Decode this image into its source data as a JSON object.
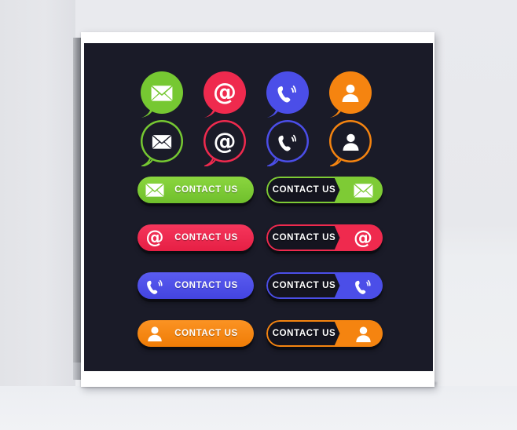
{
  "artboard": {
    "background_color": "#1a1b28",
    "frame_color": "#ffffff",
    "wall_color": "#e8e9ed"
  },
  "palette": {
    "green": "#76c832",
    "green_light": "#8bd63f",
    "red": "#ef2a4e",
    "red_light": "#f5365c",
    "blue": "#4b4ee8",
    "blue_light": "#5a5cf0",
    "orange": "#f58410",
    "orange_light": "#fb9323",
    "white": "#ffffff",
    "dark": "#14141f"
  },
  "bubbles_filled": [
    {
      "id": "bubble-filled-mail",
      "icon": "envelope-icon",
      "color": "#76c832",
      "style": "filled"
    },
    {
      "id": "bubble-filled-email",
      "icon": "at-sign-icon",
      "color": "#ef2a4e",
      "style": "filled"
    },
    {
      "id": "bubble-filled-phone",
      "icon": "phone-ringing-icon",
      "color": "#4b4ee8",
      "style": "filled"
    },
    {
      "id": "bubble-filled-user",
      "icon": "user-icon",
      "color": "#f58410",
      "style": "filled"
    }
  ],
  "bubbles_outline": [
    {
      "id": "bubble-outline-mail",
      "icon": "envelope-icon",
      "color": "#76c832",
      "style": "outline"
    },
    {
      "id": "bubble-outline-email",
      "icon": "at-sign-icon",
      "color": "#ef2a4e",
      "style": "outline"
    },
    {
      "id": "bubble-outline-phone",
      "icon": "phone-ringing-icon",
      "color": "#4b4ee8",
      "style": "outline"
    },
    {
      "id": "bubble-outline-user",
      "icon": "user-icon",
      "color": "#f58410",
      "style": "outline"
    }
  ],
  "buttons": {
    "label": "CONTACT US",
    "rows": [
      {
        "color": "#76c832",
        "icon": "envelope-icon",
        "solid": {
          "id": "contact-us-button-green-solid",
          "label": "CONTACT US",
          "icon_side": "left"
        },
        "split": {
          "id": "contact-us-button-green-split",
          "label": "CONTACT US",
          "icon_side": "right"
        }
      },
      {
        "color": "#ef2a4e",
        "icon": "at-sign-icon",
        "solid": {
          "id": "contact-us-button-red-solid",
          "label": "CONTACT US",
          "icon_side": "left"
        },
        "split": {
          "id": "contact-us-button-red-split",
          "label": "CONTACT US",
          "icon_side": "right"
        }
      },
      {
        "color": "#4b4ee8",
        "icon": "phone-ringing-icon",
        "solid": {
          "id": "contact-us-button-blue-solid",
          "label": "CONTACT US",
          "icon_side": "left"
        },
        "split": {
          "id": "contact-us-button-blue-split",
          "label": "CONTACT US",
          "icon_side": "right"
        }
      },
      {
        "color": "#f58410",
        "icon": "user-icon",
        "solid": {
          "id": "contact-us-button-orange-solid",
          "label": "CONTACT US",
          "icon_side": "left"
        },
        "split": {
          "id": "contact-us-button-orange-split",
          "label": "CONTACT US",
          "icon_side": "right"
        }
      }
    ]
  }
}
